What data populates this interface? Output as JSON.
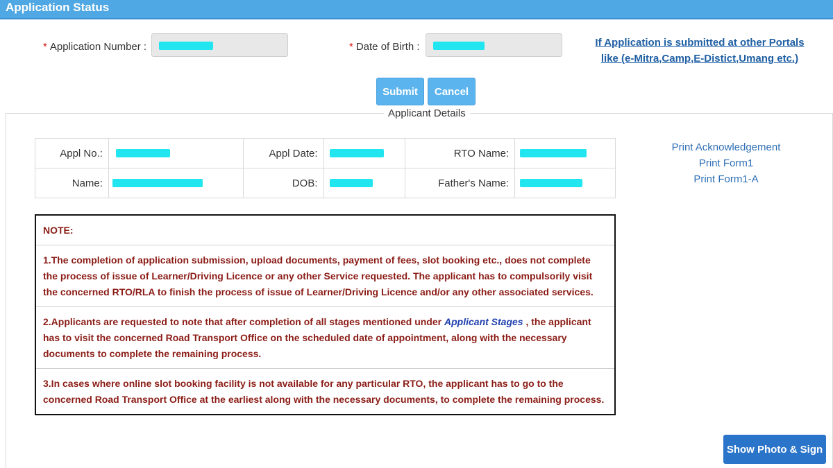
{
  "header": {
    "title": "Application Status"
  },
  "form": {
    "required_mark": "*",
    "application_number_label": "Application Number :",
    "dob_label": "Date of Birth :",
    "portal_link": "If Application is submitted at other Portals like (e-Mitra,Camp,E-Distict,Umang etc.)",
    "submit_label": "Submit",
    "cancel_label": "Cancel"
  },
  "applicant_details": {
    "legend": "Applicant Details",
    "labels": {
      "appl_no": "Appl No.:",
      "appl_date": "Appl Date:",
      "rto_name": "RTO Name:",
      "name": "Name:",
      "dob": "DOB:",
      "fathers_name": "Father's Name:"
    }
  },
  "side_links": [
    "Print Acknowledgement",
    "Print Form1",
    "Print Form1-A"
  ],
  "note": {
    "heading": "NOTE:",
    "item1": "1.The completion of application submission, upload documents, payment of fees, slot booking etc., does not complete the process of issue of Learner/Driving Licence or any other Service requested. The applicant has to compulsorily visit the concerned RTO/RLA to finish the process of issue of Learner/Driving Licence and/or any other associated services.",
    "item2_before": "2.Applicants are requested to note that after completion of all stages mentioned under ",
    "item2_link": "Applicant Stages",
    "item2_after": " , the applicant has to visit the concerned Road Transport Office on the scheduled date of appointment, along with the necessary documents to complete the remaining process.",
    "item3": "3.In cases where online slot booking facility is not available for any particular RTO, the applicant has to go to the concerned Road Transport Office at the earliest along with the necessary documents, to complete the remaining process."
  },
  "actions": {
    "show_photo_sign": "Show Photo & Sign"
  },
  "colors": {
    "header_bar": "#4fa7e3",
    "button": "#5bb4ee",
    "note_text": "#8b1c16",
    "redaction": "#22e6ef",
    "primary_button": "#2a74c9"
  }
}
